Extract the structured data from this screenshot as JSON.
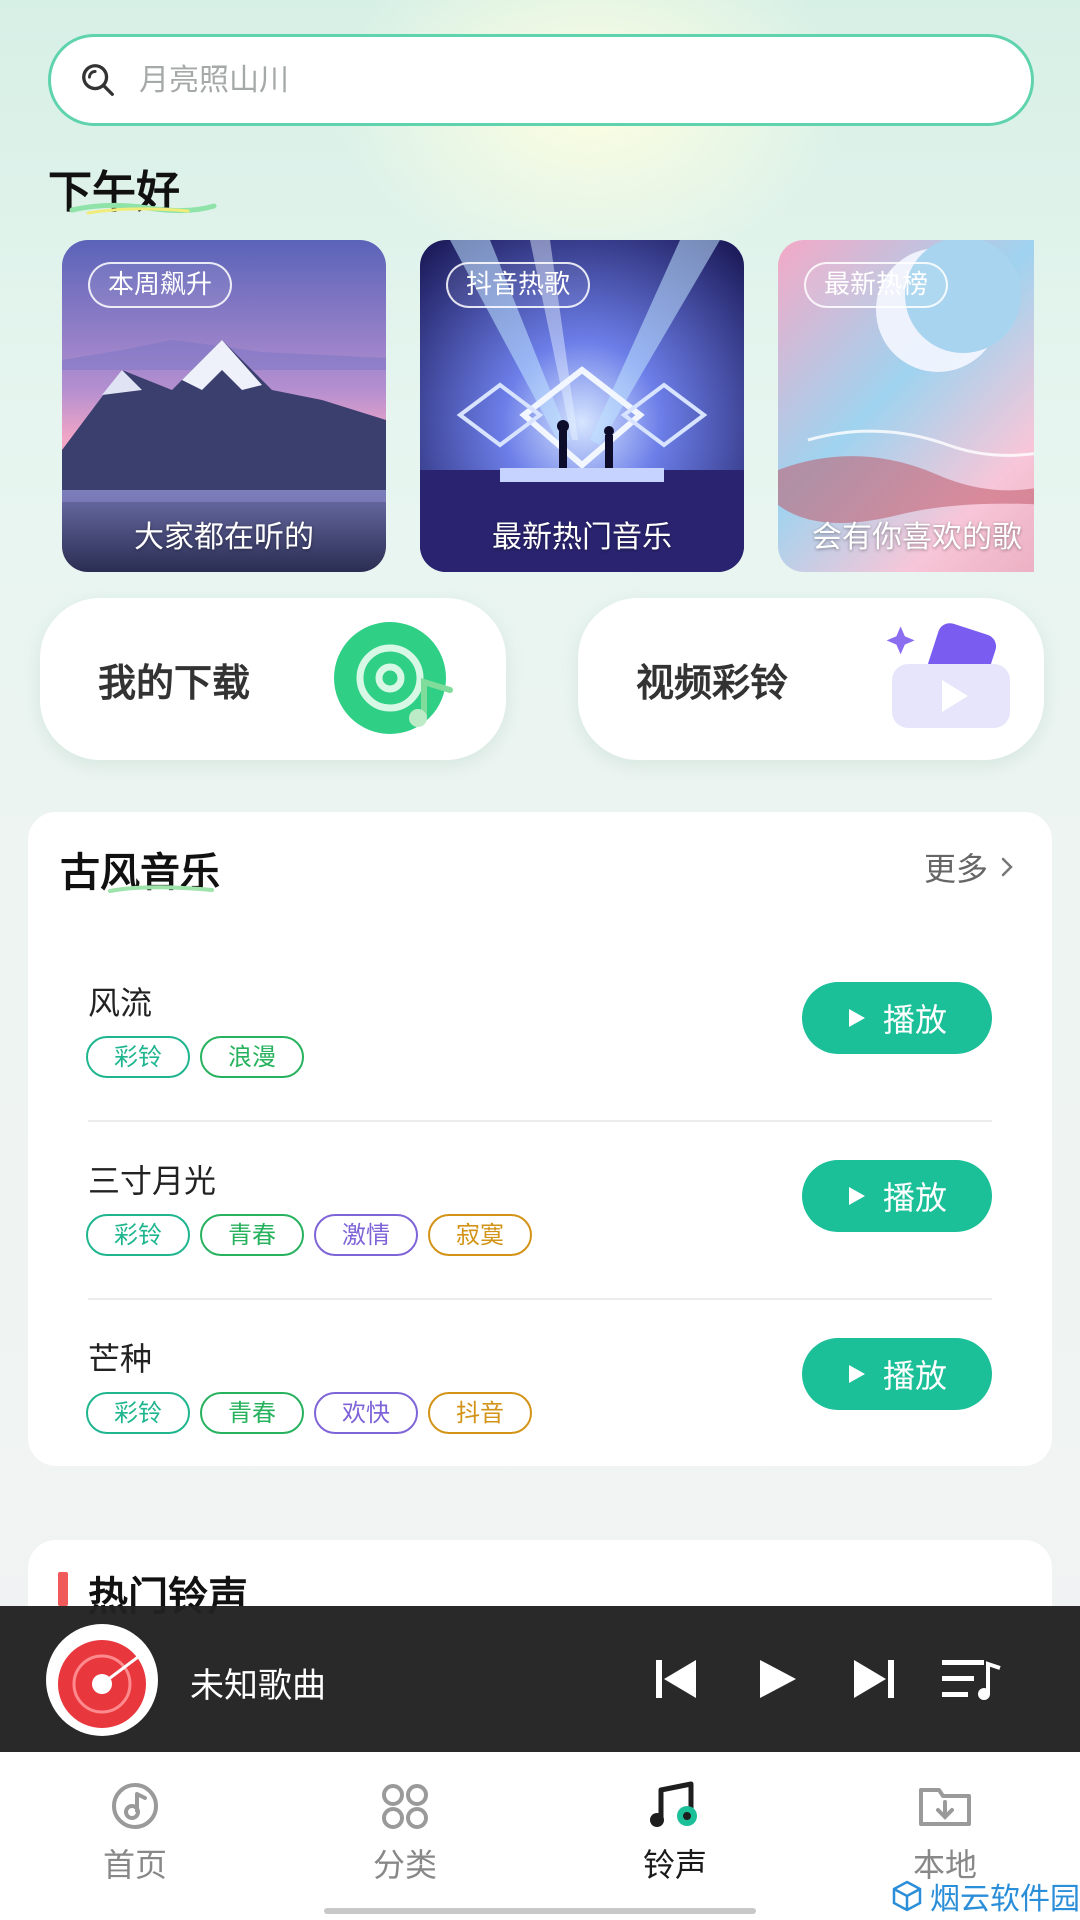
{
  "search": {
    "placeholder": "月亮照山川",
    "icon": "search-icon"
  },
  "greeting": "下午好",
  "banners": [
    {
      "tag": "本周飙升",
      "title": "大家都在听的"
    },
    {
      "tag": "抖音热歌",
      "title": "最新热门音乐"
    },
    {
      "tag": "最新热榜",
      "title": "会有你喜欢的歌"
    }
  ],
  "shortcuts": [
    {
      "label": "我的下载",
      "icon": "music-disc-icon"
    },
    {
      "label": "视频彩铃",
      "icon": "video-play-icon"
    }
  ],
  "section_ancient": {
    "title": "古风音乐",
    "more": "更多",
    "songs": [
      {
        "name": "风流",
        "tags": [
          "彩铃",
          "浪漫"
        ],
        "play": "播放"
      },
      {
        "name": "三寸月光",
        "tags": [
          "彩铃",
          "青春",
          "激情",
          "寂寞"
        ],
        "play": "播放"
      },
      {
        "name": "芒种",
        "tags": [
          "彩铃",
          "青春",
          "欢快",
          "抖音"
        ],
        "play": "播放"
      }
    ]
  },
  "section_hot": {
    "title": "热门铃声"
  },
  "player": {
    "song": "未知歌曲"
  },
  "nav": [
    {
      "label": "首页",
      "icon": "home-music-icon"
    },
    {
      "label": "分类",
      "icon": "category-grid-icon"
    },
    {
      "label": "铃声",
      "icon": "ringtone-icon"
    },
    {
      "label": "本地",
      "icon": "local-folder-icon"
    }
  ],
  "watermark": "烟云软件园",
  "colors": {
    "accent": "#1bbf98",
    "search_border": "#5fd3ae",
    "player_bg": "#222222",
    "hot_bar": "#f05a5a"
  }
}
